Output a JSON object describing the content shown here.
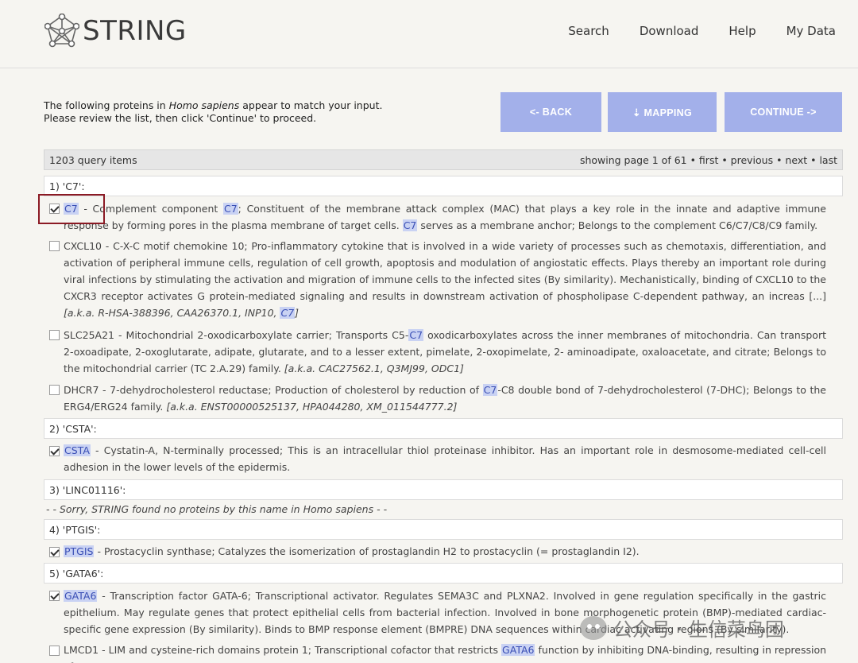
{
  "header": {
    "logo_text": "STRING",
    "nav": [
      "Search",
      "Download",
      "Help",
      "My Data"
    ]
  },
  "intro": {
    "line1_prefix": "The following proteins in ",
    "species": "Homo sapiens",
    "line1_suffix": " appear to match your input.",
    "line2": "Please review the list, then click 'Continue' to proceed."
  },
  "buttons": {
    "back": "<- BACK",
    "mapping": "⇣ MAPPING",
    "continue": "CONTINUE ->"
  },
  "summary": {
    "count": "1203 query items",
    "paging": "showing page 1 of 61 • first • previous • next • last"
  },
  "queries": {
    "q1": "1) 'C7':",
    "q2": "2) 'CSTA':",
    "q3": "3) 'LINC01116':",
    "q4": "4) 'PTGIS':",
    "q5": "5) 'GATA6':"
  },
  "sorry": "- - Sorry, STRING found no proteins by this name in Homo sapiens - -",
  "items": {
    "c7": {
      "name": "C7",
      "t1": " - Complement component ",
      "h1": "C7",
      "t2": "; Constituent of the membrane attack complex (MAC) that plays a key role in the innate and adaptive immune response by forming pores in the plasma membrane of target cells. ",
      "h2": "C7",
      "t3": " serves as a membrane anchor; Belongs to the complement C6/C7/C8/C9 family."
    },
    "cxcl10": {
      "text": "CXCL10 - C-X-C motif chemokine 10; Pro-inflammatory cytokine that is involved in a wide variety of processes such as chemotaxis, differentiation, and activation of peripheral immune cells, regulation of cell growth, apoptosis and modulation of angiostatic effects. Plays thereby an important role during viral infections by stimulating the activation and migration of immune cells to the infected sites (By similarity). Mechanistically, binding of CXCL10 to the CXCR3 receptor activates G protein-mediated signaling and results in downstream activation of phospholipase C-dependent pathway, an increas [...] ",
      "aka": "[a.k.a. R-HSA-388396, CAA26370.1, INP10, ",
      "aka_hl": "C7",
      "aka_end": "]"
    },
    "slc25a21": {
      "t1": "SLC25A21 - Mitochondrial 2-oxodicarboxylate carrier; Transports C5-",
      "h1": "C7",
      "t2": " oxodicarboxylates across the inner membranes of mitochondria. Can transport 2-oxoadipate, 2-oxoglutarate, adipate, glutarate, and to a lesser extent, pimelate, 2-oxopimelate, 2- aminoadipate, oxaloacetate, and citrate; Belongs to the mitochondrial carrier (TC 2.A.29) family. ",
      "aka": "[a.k.a. CAC27562.1, Q3MJ99, ODC1]"
    },
    "dhcr7": {
      "t1": "DHCR7 - 7-dehydrocholesterol reductase; Production of cholesterol by reduction of ",
      "h1": "C7",
      "t2": "-C8 double bond of 7-dehydrocholesterol (7-DHC); Belongs to the ERG4/ERG24 family. ",
      "aka": "[a.k.a. ENST00000525137, HPA044280, XM_011544777.2]"
    },
    "csta": {
      "name": "CSTA",
      "text": " - Cystatin-A, N-terminally processed; This is an intracellular thiol proteinase inhibitor. Has an important role in desmosome-mediated cell-cell adhesion in the lower levels of the epidermis."
    },
    "ptgis": {
      "name": "PTGIS",
      "text": " - Prostacyclin synthase; Catalyzes the isomerization of prostaglandin H2 to prostacyclin (= prostaglandin I2)."
    },
    "gata6": {
      "name": "GATA6",
      "text": " - Transcription factor GATA-6; Transcriptional activator. Regulates SEMA3C and PLXNA2. Involved in gene regulation specifically in the gastric epithelium. May regulate genes that protect epithelial cells from bacterial infection. Involved in bone morphogenetic protein (BMP)-mediated cardiac-specific gene expression (By similarity). Binds to BMP response element (BMPRE) DNA sequences within cardiac activating regions (By similarity)."
    },
    "lmcd1": {
      "t1": "LMCD1 - LIM and cysteine-rich domains protein 1; Transcriptional cofactor that restricts ",
      "h1": "GATA6",
      "t2": " function by inhibiting DNA-binding, resulting in repression of"
    }
  },
  "watermark": "公众号 · 生信菜鸟团"
}
